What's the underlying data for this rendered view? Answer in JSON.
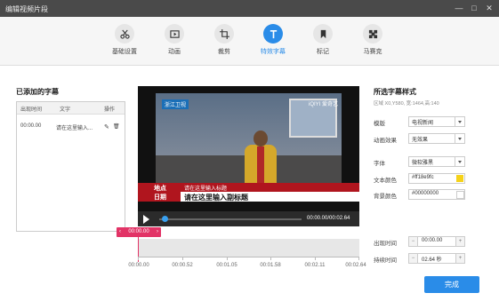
{
  "window": {
    "title": "编辑视频片段",
    "min": "—",
    "max": "□",
    "close": "✕"
  },
  "toolbar": {
    "tabs": [
      {
        "label": "基础设置",
        "icon": "scissors-icon"
      },
      {
        "label": "动画",
        "icon": "animation-icon"
      },
      {
        "label": "裁剪",
        "icon": "crop-icon"
      },
      {
        "label": "特效字幕",
        "icon": "text-t-icon",
        "active": true
      },
      {
        "label": "标记",
        "icon": "bookmark-icon"
      },
      {
        "label": "马赛克",
        "icon": "mosaic-icon"
      }
    ]
  },
  "subtitles": {
    "heading": "已添加的字幕",
    "columns": [
      "出现时间",
      "文字",
      "操作"
    ],
    "rows": [
      {
        "time": "00:00.00",
        "text": "请在这里输入...",
        "edit": "✎",
        "delete": "🗑"
      }
    ]
  },
  "preview": {
    "channel_logo": "浙江卫视",
    "watermark": "iQIYI 爱奇艺",
    "caption_label_1": "地点",
    "caption_text_1": "请在这里输入标题",
    "caption_label_2": "日期",
    "caption_text_2": "请在这里输入副标题",
    "time": "00:00.00/00:02.64",
    "progress": 0.02
  },
  "timeline": {
    "current": "00:00.00",
    "ticks": [
      "00:00.00",
      "00:00.52",
      "00:01.05",
      "00:01.58",
      "00:02.11",
      "00:02.64"
    ]
  },
  "style": {
    "heading": "所选字幕样式",
    "region": "区域 X0,Y580, 宽:1464,高:140",
    "template_label": "模版",
    "template_value": "电视新闻",
    "anim_label": "动画效果",
    "anim_value": "无效果",
    "font_label": "字体",
    "font_value": "微软雅黑",
    "text_color_label": "文本颜色",
    "text_color_value": "#ff18e9fc",
    "text_color_swatch": "#f5d21a",
    "bg_color_label": "背景颜色",
    "bg_color_value": "#00000000",
    "bg_color_swatch": "#ffffff",
    "appear_label": "出现时间",
    "appear_value": "00:00.00",
    "duration_label": "持续时间",
    "duration_value": "02.64 秒",
    "minus": "−",
    "plus": "+"
  },
  "done_button": "完成",
  "colors": {
    "accent": "#2a8ce8",
    "caption_red": "#b0151e",
    "timeline_marker": "#e23366"
  }
}
